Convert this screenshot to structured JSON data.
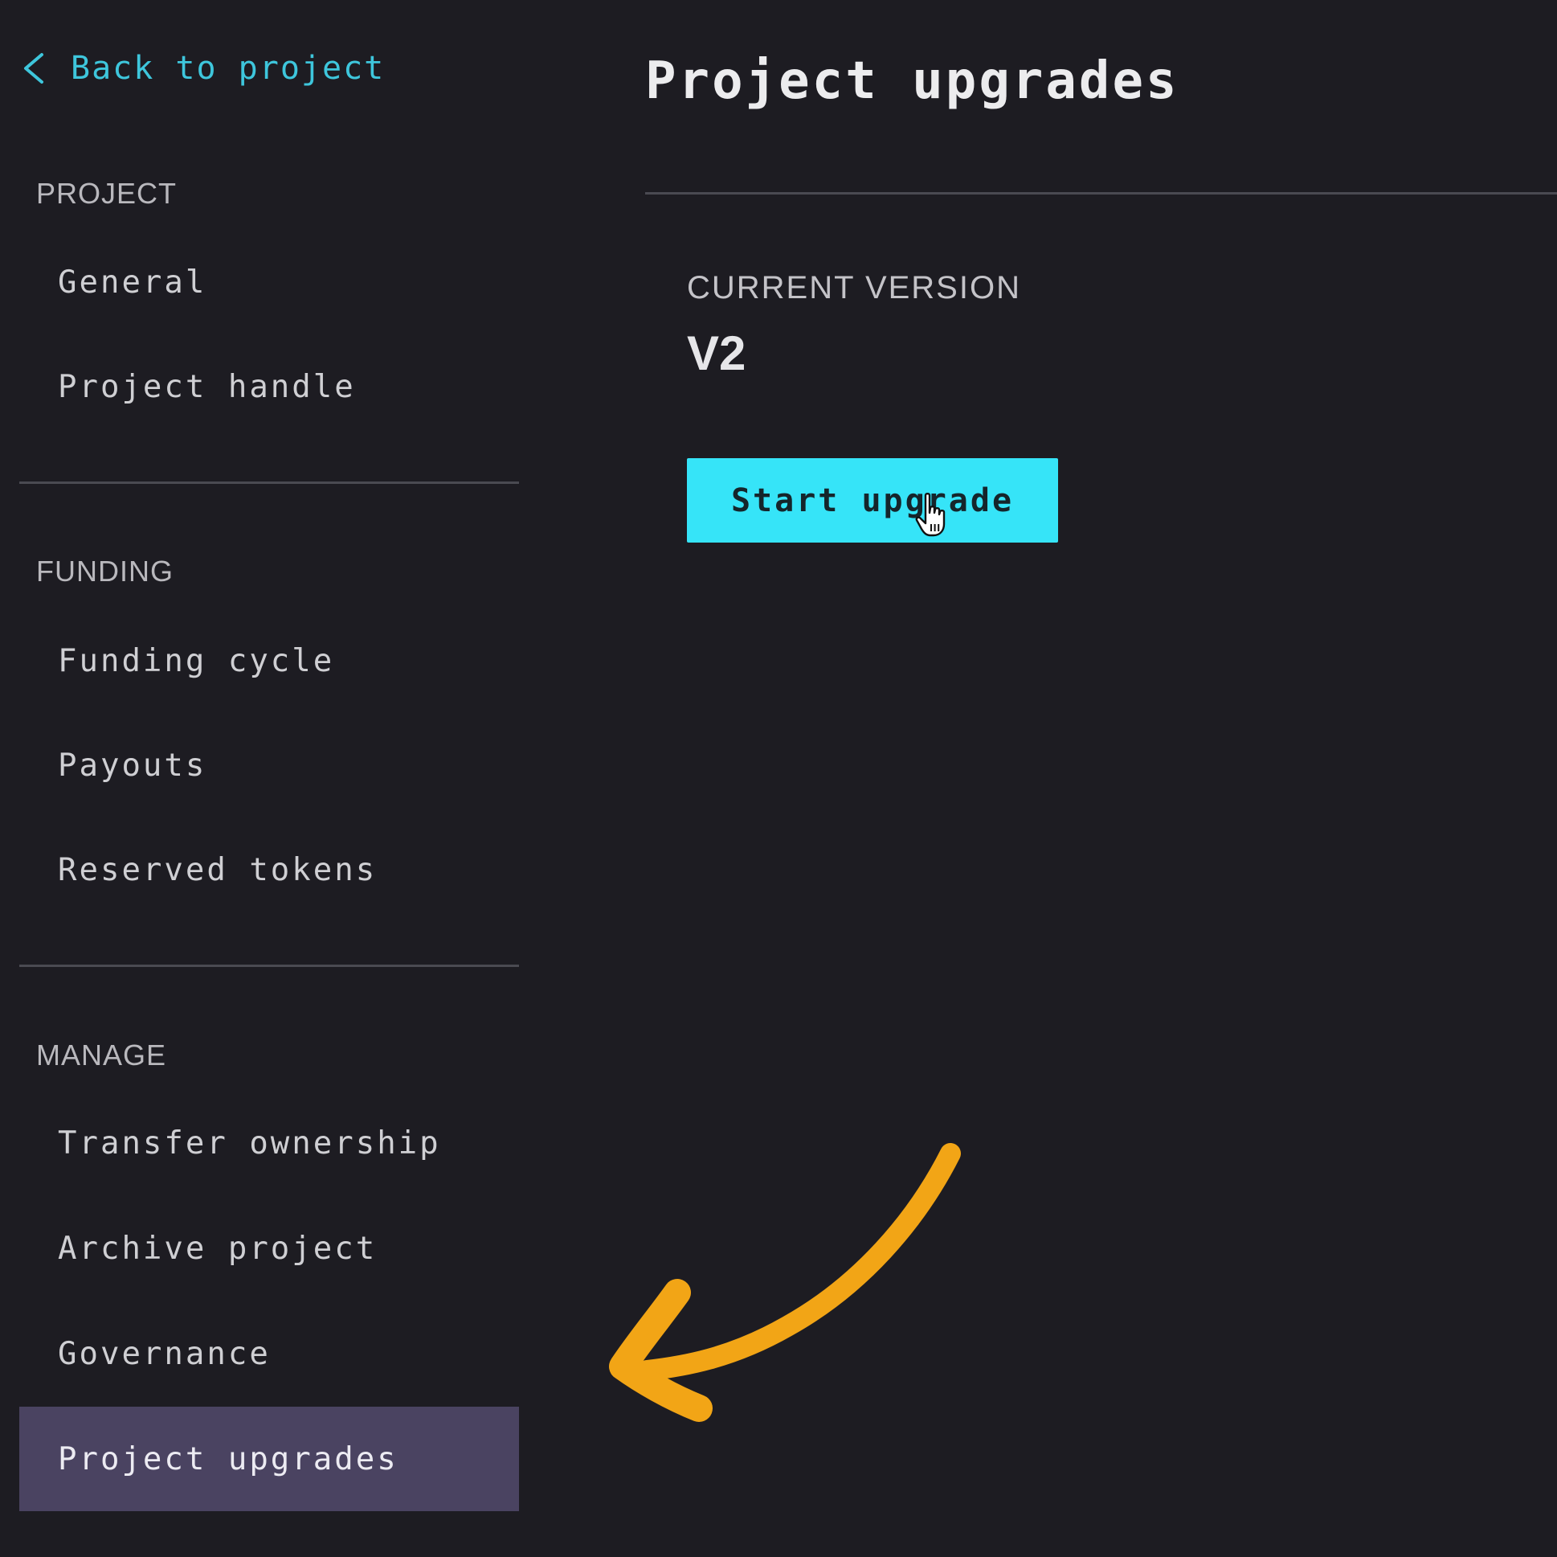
{
  "sidebar": {
    "back_link": "Back to project",
    "sections": [
      {
        "label": "PROJECT",
        "items": [
          {
            "label": "General"
          },
          {
            "label": "Project handle"
          }
        ]
      },
      {
        "label": "FUNDING",
        "items": [
          {
            "label": "Funding cycle"
          },
          {
            "label": "Payouts"
          },
          {
            "label": "Reserved tokens"
          }
        ]
      },
      {
        "label": "MANAGE",
        "items": [
          {
            "label": "Transfer ownership"
          },
          {
            "label": "Archive project"
          },
          {
            "label": "Governance"
          },
          {
            "label": "Project upgrades",
            "active": true
          }
        ]
      }
    ]
  },
  "main": {
    "title": "Project upgrades",
    "current_version_label": "CURRENT VERSION",
    "current_version_value": "V2",
    "start_upgrade_label": "Start upgrade"
  },
  "colors": {
    "background": "#1d1c22",
    "accent": "#36e4f8",
    "link": "#3ec6dc",
    "active_item": "#4a4361",
    "annotation_arrow": "#f2a516"
  }
}
